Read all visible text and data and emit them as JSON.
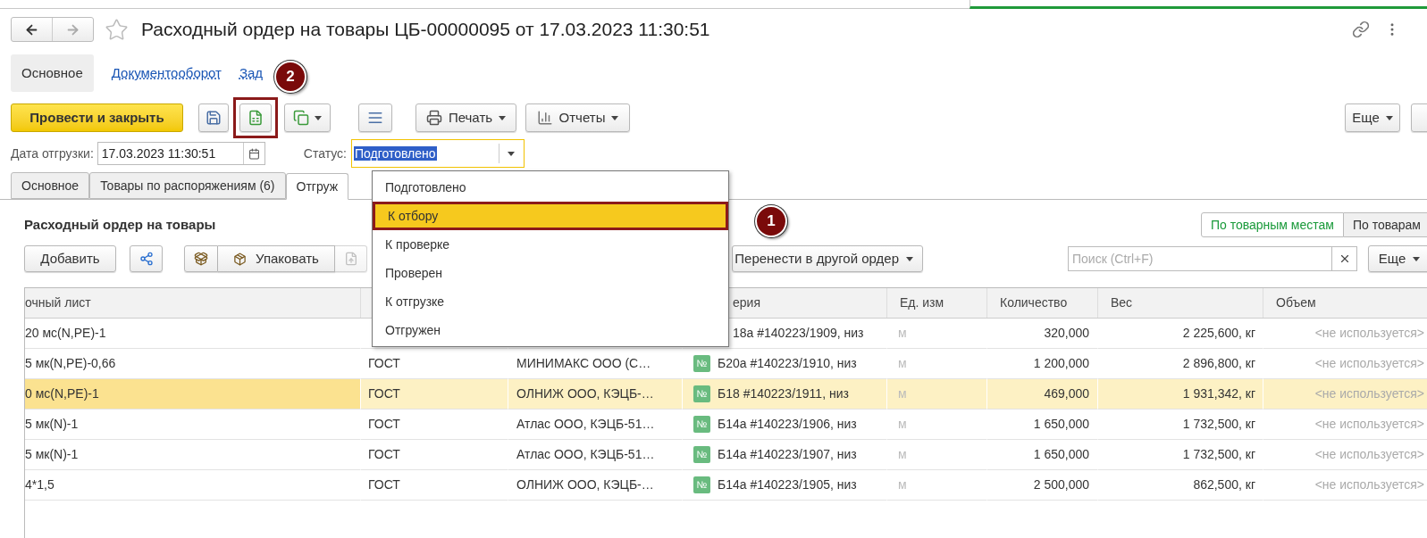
{
  "header": {
    "title": "Расходный ордер на товары ЦБ-00000095 от 17.03.2023 11:30:51"
  },
  "nav_tabs": [
    {
      "label": "Основное",
      "selected": true
    },
    {
      "label": "Документооборот",
      "selected": false
    },
    {
      "label": "Зад",
      "selected": false
    }
  ],
  "toolbar": {
    "primary": "Провести и закрыть",
    "icon_buttons": [
      {
        "highlighted": false
      },
      {
        "highlighted": true
      },
      {
        "highlighted": false
      },
      {
        "highlighted": false
      }
    ],
    "print": "Печать",
    "reports": "Отчеты",
    "more": "Еще"
  },
  "fields": {
    "date_label": "Дата отгрузки:",
    "date_value": "17.03.2023 11:30:51",
    "status_label": "Статус:",
    "status_value": "Подготовлено"
  },
  "status_dropdown": {
    "options": [
      {
        "label": "Подготовлено",
        "selected": false
      },
      {
        "label": "К отбору",
        "selected": true
      },
      {
        "label": "К проверке",
        "selected": false
      },
      {
        "label": "Проверен",
        "selected": false
      },
      {
        "label": "К отгрузке",
        "selected": false
      },
      {
        "label": "Отгружен",
        "selected": false
      }
    ]
  },
  "form_tabs": [
    {
      "label": "Основное",
      "selected": false
    },
    {
      "label": "Товары по распоряжениям (6)",
      "selected": false
    },
    {
      "label": "Отгруж",
      "selected": true
    }
  ],
  "panel": {
    "title": "Расходный ордер на товары",
    "view_toggle": [
      {
        "label": "По товарным местам",
        "selected": true
      },
      {
        "label": "По товарам",
        "selected": false
      }
    ],
    "add": "Добавить",
    "pack": "Упаковать",
    "move": "Перенести в другой ордер",
    "search_placeholder": "Поиск (Ctrl+F)",
    "more": "Еще"
  },
  "table": {
    "columns": [
      "очный лист",
      "ерия",
      "Ед. изм",
      "Количество",
      "Вес",
      "Объем"
    ],
    "rows": [
      {
        "sheet": "20 мс(N,PE)-1",
        "series": "18а #140223/1909, низ",
        "unit": "м",
        "quantity": "320,000",
        "weight": "2 225,600, кг",
        "volume": "<не используется>",
        "selected": false
      },
      {
        "sheet": "5 мк(N,PE)-0,66",
        "standard": "ГОСТ",
        "supplier": "МИНИМАКС ООО (С…",
        "badge": "№",
        "series": "Б20а #140223/1910, низ",
        "unit": "м",
        "quantity": "1 200,000",
        "weight": "2 896,800, кг",
        "volume": "<не используется>",
        "selected": false
      },
      {
        "sheet": "0 мс(N,PE)-1",
        "standard": "ГОСТ",
        "supplier": "ОЛНИЖ ООО, КЭЦБ-…",
        "badge": "№",
        "series": "Б18 #140223/1911, низ",
        "unit": "м",
        "quantity": "469,000",
        "weight": "1 931,342, кг",
        "volume": "<не используется>",
        "selected": true
      },
      {
        "sheet": "5 мк(N)-1",
        "standard": "ГОСТ",
        "supplier": "Атлас ООО, КЭЦБ-51…",
        "badge": "№",
        "series": "Б14а #140223/1906, низ",
        "unit": "м",
        "quantity": "1 650,000",
        "weight": "1 732,500, кг",
        "volume": "<не используется>",
        "selected": false
      },
      {
        "sheet": "5 мк(N)-1",
        "standard": "ГОСТ",
        "supplier": "Атлас ООО, КЭЦБ-51…",
        "badge": "№",
        "series": "Б14а #140223/1907, низ",
        "unit": "м",
        "quantity": "1 650,000",
        "weight": "1 732,500, кг",
        "volume": "<не используется>",
        "selected": false
      },
      {
        "sheet": "4*1,5",
        "standard": "ГОСТ",
        "supplier": "ОЛНИЖ ООО, КЭЦБ-…",
        "badge": "№",
        "series": "Б14а #140223/1905, низ",
        "unit": "м",
        "quantity": "2 500,000",
        "weight": "862,500, кг",
        "volume": "<не используется>",
        "selected": false
      }
    ]
  },
  "callouts": [
    {
      "label": "2"
    },
    {
      "label": "1"
    }
  ]
}
